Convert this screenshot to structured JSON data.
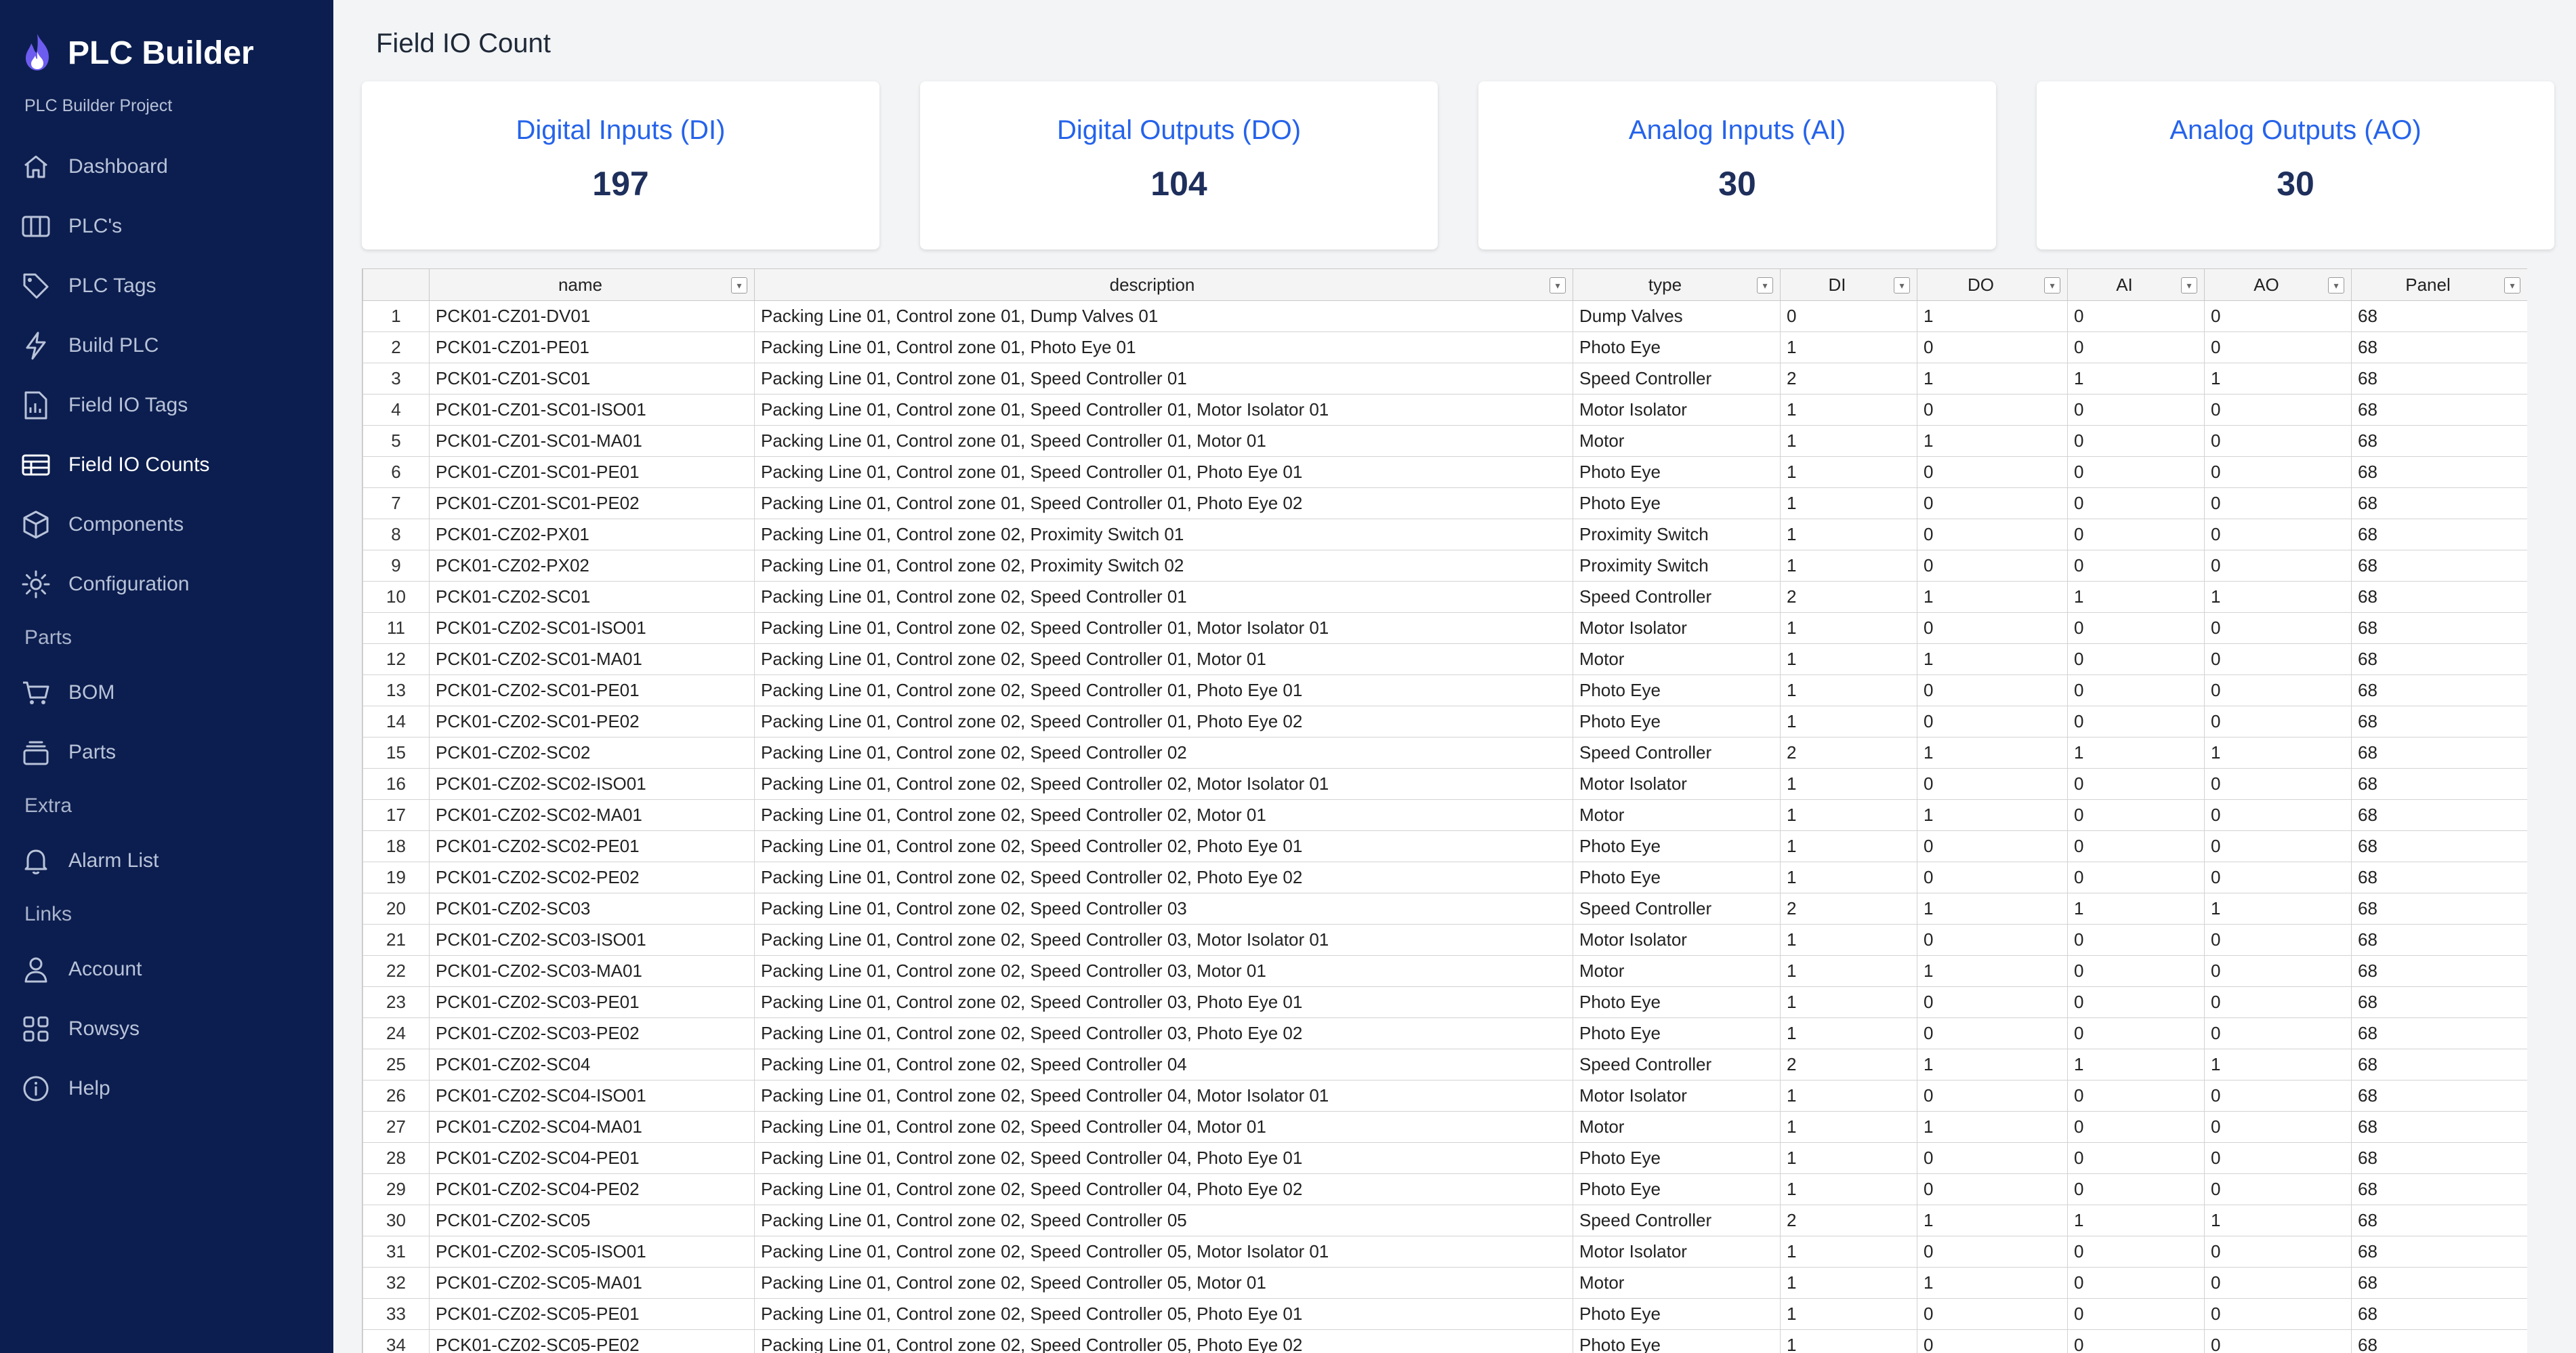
{
  "app": {
    "title": "PLC Builder",
    "project": "PLC Builder Project"
  },
  "sidebar": {
    "items": [
      {
        "label": "Dashboard",
        "icon": "home-icon"
      },
      {
        "label": "PLC's",
        "icon": "columns-icon"
      },
      {
        "label": "PLC Tags",
        "icon": "tag-icon"
      },
      {
        "label": "Build PLC",
        "icon": "bolt-icon"
      },
      {
        "label": "Field IO Tags",
        "icon": "file-chart-icon"
      },
      {
        "label": "Field IO Counts",
        "icon": "table-icon",
        "active": true
      },
      {
        "label": "Components",
        "icon": "cube-icon"
      },
      {
        "label": "Configuration",
        "icon": "gear-icon"
      },
      {
        "label": "BOM",
        "icon": "cart-icon"
      },
      {
        "label": "Parts",
        "icon": "stack-icon"
      },
      {
        "label": "Alarm List",
        "icon": "bell-icon"
      },
      {
        "label": "Account",
        "icon": "user-icon"
      },
      {
        "label": "Rowsys",
        "icon": "grid-icon"
      },
      {
        "label": "Help",
        "icon": "info-icon"
      }
    ],
    "sections": [
      "Parts",
      "Extra",
      "Links"
    ]
  },
  "page": {
    "title": "Field IO Count"
  },
  "cards": [
    {
      "title": "Digital Inputs (DI)",
      "value": "197"
    },
    {
      "title": "Digital Outputs (DO)",
      "value": "104"
    },
    {
      "title": "Analog Inputs (AI)",
      "value": "30"
    },
    {
      "title": "Analog Outputs (AO)",
      "value": "30"
    }
  ],
  "colors": {
    "sidebar_bg": "#0c1e4f",
    "accent": "#2563eb",
    "card_value": "#1e2f5c"
  },
  "table": {
    "columns": [
      "name",
      "description",
      "type",
      "DI",
      "DO",
      "AI",
      "AO",
      "Panel"
    ],
    "rows": [
      [
        "1",
        "PCK01-CZ01-DV01",
        "Packing Line 01, Control zone 01, Dump Valves 01",
        "Dump Valves",
        "0",
        "1",
        "0",
        "0",
        "68"
      ],
      [
        "2",
        "PCK01-CZ01-PE01",
        "Packing Line 01, Control zone 01, Photo Eye 01",
        "Photo Eye",
        "1",
        "0",
        "0",
        "0",
        "68"
      ],
      [
        "3",
        "PCK01-CZ01-SC01",
        "Packing Line 01, Control zone 01, Speed Controller 01",
        "Speed Controller",
        "2",
        "1",
        "1",
        "1",
        "68"
      ],
      [
        "4",
        "PCK01-CZ01-SC01-ISO01",
        "Packing Line 01, Control zone 01, Speed Controller 01, Motor Isolator 01",
        "Motor Isolator",
        "1",
        "0",
        "0",
        "0",
        "68"
      ],
      [
        "5",
        "PCK01-CZ01-SC01-MA01",
        "Packing Line 01, Control zone 01, Speed Controller 01, Motor 01",
        "Motor",
        "1",
        "1",
        "0",
        "0",
        "68"
      ],
      [
        "6",
        "PCK01-CZ01-SC01-PE01",
        "Packing Line 01, Control zone 01, Speed Controller 01, Photo Eye 01",
        "Photo Eye",
        "1",
        "0",
        "0",
        "0",
        "68"
      ],
      [
        "7",
        "PCK01-CZ01-SC01-PE02",
        "Packing Line 01, Control zone 01, Speed Controller 01, Photo Eye 02",
        "Photo Eye",
        "1",
        "0",
        "0",
        "0",
        "68"
      ],
      [
        "8",
        "PCK01-CZ02-PX01",
        "Packing Line 01, Control zone 02, Proximity Switch 01",
        "Proximity Switch",
        "1",
        "0",
        "0",
        "0",
        "68"
      ],
      [
        "9",
        "PCK01-CZ02-PX02",
        "Packing Line 01, Control zone 02, Proximity Switch 02",
        "Proximity Switch",
        "1",
        "0",
        "0",
        "0",
        "68"
      ],
      [
        "10",
        "PCK01-CZ02-SC01",
        "Packing Line 01, Control zone 02, Speed Controller 01",
        "Speed Controller",
        "2",
        "1",
        "1",
        "1",
        "68"
      ],
      [
        "11",
        "PCK01-CZ02-SC01-ISO01",
        "Packing Line 01, Control zone 02, Speed Controller 01, Motor Isolator 01",
        "Motor Isolator",
        "1",
        "0",
        "0",
        "0",
        "68"
      ],
      [
        "12",
        "PCK01-CZ02-SC01-MA01",
        "Packing Line 01, Control zone 02, Speed Controller 01, Motor 01",
        "Motor",
        "1",
        "1",
        "0",
        "0",
        "68"
      ],
      [
        "13",
        "PCK01-CZ02-SC01-PE01",
        "Packing Line 01, Control zone 02, Speed Controller 01, Photo Eye 01",
        "Photo Eye",
        "1",
        "0",
        "0",
        "0",
        "68"
      ],
      [
        "14",
        "PCK01-CZ02-SC01-PE02",
        "Packing Line 01, Control zone 02, Speed Controller 01, Photo Eye 02",
        "Photo Eye",
        "1",
        "0",
        "0",
        "0",
        "68"
      ],
      [
        "15",
        "PCK01-CZ02-SC02",
        "Packing Line 01, Control zone 02, Speed Controller 02",
        "Speed Controller",
        "2",
        "1",
        "1",
        "1",
        "68"
      ],
      [
        "16",
        "PCK01-CZ02-SC02-ISO01",
        "Packing Line 01, Control zone 02, Speed Controller 02, Motor Isolator 01",
        "Motor Isolator",
        "1",
        "0",
        "0",
        "0",
        "68"
      ],
      [
        "17",
        "PCK01-CZ02-SC02-MA01",
        "Packing Line 01, Control zone 02, Speed Controller 02, Motor 01",
        "Motor",
        "1",
        "1",
        "0",
        "0",
        "68"
      ],
      [
        "18",
        "PCK01-CZ02-SC02-PE01",
        "Packing Line 01, Control zone 02, Speed Controller 02, Photo Eye 01",
        "Photo Eye",
        "1",
        "0",
        "0",
        "0",
        "68"
      ],
      [
        "19",
        "PCK01-CZ02-SC02-PE02",
        "Packing Line 01, Control zone 02, Speed Controller 02, Photo Eye 02",
        "Photo Eye",
        "1",
        "0",
        "0",
        "0",
        "68"
      ],
      [
        "20",
        "PCK01-CZ02-SC03",
        "Packing Line 01, Control zone 02, Speed Controller 03",
        "Speed Controller",
        "2",
        "1",
        "1",
        "1",
        "68"
      ],
      [
        "21",
        "PCK01-CZ02-SC03-ISO01",
        "Packing Line 01, Control zone 02, Speed Controller 03, Motor Isolator 01",
        "Motor Isolator",
        "1",
        "0",
        "0",
        "0",
        "68"
      ],
      [
        "22",
        "PCK01-CZ02-SC03-MA01",
        "Packing Line 01, Control zone 02, Speed Controller 03, Motor 01",
        "Motor",
        "1",
        "1",
        "0",
        "0",
        "68"
      ],
      [
        "23",
        "PCK01-CZ02-SC03-PE01",
        "Packing Line 01, Control zone 02, Speed Controller 03, Photo Eye 01",
        "Photo Eye",
        "1",
        "0",
        "0",
        "0",
        "68"
      ],
      [
        "24",
        "PCK01-CZ02-SC03-PE02",
        "Packing Line 01, Control zone 02, Speed Controller 03, Photo Eye 02",
        "Photo Eye",
        "1",
        "0",
        "0",
        "0",
        "68"
      ],
      [
        "25",
        "PCK01-CZ02-SC04",
        "Packing Line 01, Control zone 02, Speed Controller 04",
        "Speed Controller",
        "2",
        "1",
        "1",
        "1",
        "68"
      ],
      [
        "26",
        "PCK01-CZ02-SC04-ISO01",
        "Packing Line 01, Control zone 02, Speed Controller 04, Motor Isolator 01",
        "Motor Isolator",
        "1",
        "0",
        "0",
        "0",
        "68"
      ],
      [
        "27",
        "PCK01-CZ02-SC04-MA01",
        "Packing Line 01, Control zone 02, Speed Controller 04, Motor 01",
        "Motor",
        "1",
        "1",
        "0",
        "0",
        "68"
      ],
      [
        "28",
        "PCK01-CZ02-SC04-PE01",
        "Packing Line 01, Control zone 02, Speed Controller 04, Photo Eye 01",
        "Photo Eye",
        "1",
        "0",
        "0",
        "0",
        "68"
      ],
      [
        "29",
        "PCK01-CZ02-SC04-PE02",
        "Packing Line 01, Control zone 02, Speed Controller 04, Photo Eye 02",
        "Photo Eye",
        "1",
        "0",
        "0",
        "0",
        "68"
      ],
      [
        "30",
        "PCK01-CZ02-SC05",
        "Packing Line 01, Control zone 02, Speed Controller 05",
        "Speed Controller",
        "2",
        "1",
        "1",
        "1",
        "68"
      ],
      [
        "31",
        "PCK01-CZ02-SC05-ISO01",
        "Packing Line 01, Control zone 02, Speed Controller 05, Motor Isolator 01",
        "Motor Isolator",
        "1",
        "0",
        "0",
        "0",
        "68"
      ],
      [
        "32",
        "PCK01-CZ02-SC05-MA01",
        "Packing Line 01, Control zone 02, Speed Controller 05, Motor 01",
        "Motor",
        "1",
        "1",
        "0",
        "0",
        "68"
      ],
      [
        "33",
        "PCK01-CZ02-SC05-PE01",
        "Packing Line 01, Control zone 02, Speed Controller 05, Photo Eye 01",
        "Photo Eye",
        "1",
        "0",
        "0",
        "0",
        "68"
      ],
      [
        "34",
        "PCK01-CZ02-SC05-PE02",
        "Packing Line 01, Control zone 02, Speed Controller 05, Photo Eye 02",
        "Photo Eye",
        "1",
        "0",
        "0",
        "0",
        "68"
      ]
    ]
  }
}
